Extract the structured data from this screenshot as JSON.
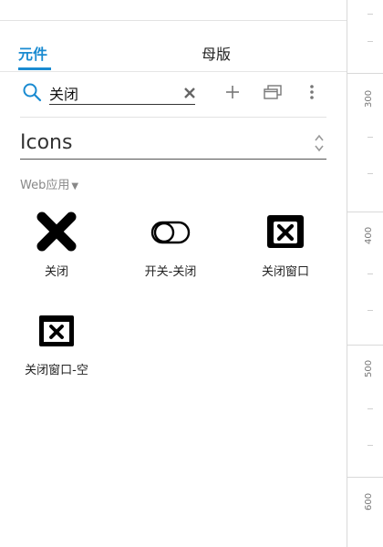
{
  "tabs": [
    {
      "label": "元件"
    },
    {
      "label": "母版"
    }
  ],
  "search": {
    "value": "关闭"
  },
  "library": {
    "name": "Icons",
    "partial_text": ""
  },
  "category": {
    "label": "Web应用"
  },
  "items": [
    {
      "label": "关闭",
      "icon": "x-icon"
    },
    {
      "label": "开关-关闭",
      "icon": "toggle-off-icon"
    },
    {
      "label": "关闭窗口",
      "icon": "close-window-icon"
    },
    {
      "label": "关闭窗口-空",
      "icon": "close-window-empty-icon"
    }
  ],
  "ruler": {
    "labels": [
      "300",
      "400",
      "500",
      "600"
    ]
  },
  "colors": {
    "accent": "#1a8bd1"
  }
}
